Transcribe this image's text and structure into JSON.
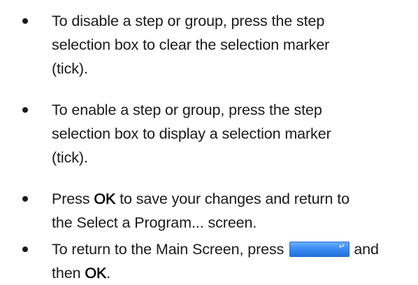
{
  "items": [
    {
      "lines": [
        "To disable a step or group, press the step",
        "selection box to clear the selection marker",
        "(tick)."
      ]
    },
    {
      "lines": [
        "To enable a step or group, press the step",
        "selection box to display a selection marker",
        "(tick)."
      ]
    },
    {
      "line1": {
        "before": "Press ",
        "keyword": "OK",
        "after": " to save your changes and return to"
      },
      "line2": "the Select a Program... screen."
    },
    {
      "line1": {
        "before": "To return to the Main Screen, press",
        "after": "and"
      },
      "line2": {
        "before": "then ",
        "keyword": "OK",
        "after": "."
      },
      "button_icon": "return-icon",
      "button_color": "#3d8ef5"
    }
  ]
}
